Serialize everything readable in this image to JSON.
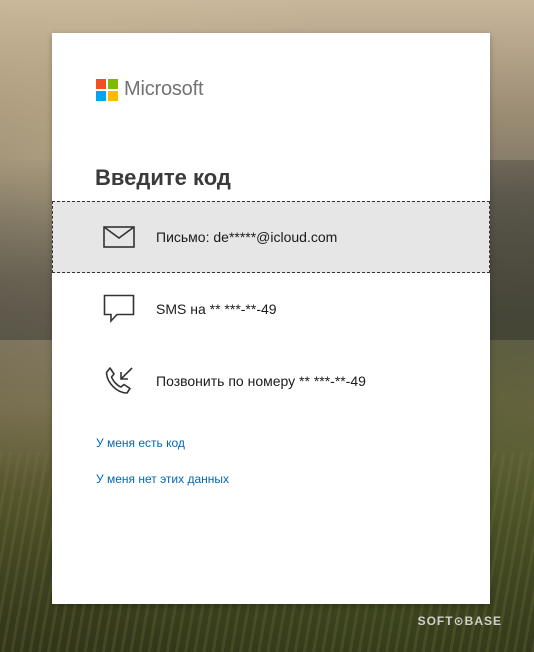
{
  "logo": {
    "text": "Microsoft",
    "colors": [
      "#f25022",
      "#7fba00",
      "#00a4ef",
      "#ffb900"
    ]
  },
  "title": "Введите код",
  "options": [
    {
      "icon": "envelope-icon",
      "label": "Письмо: de*****@icloud.com",
      "selected": true
    },
    {
      "icon": "sms-chat-icon",
      "label": "SMS на ** ***-**-49",
      "selected": false
    },
    {
      "icon": "incoming-call-icon",
      "label": "Позвонить по номеру ** ***-**-49",
      "selected": false
    }
  ],
  "links": {
    "have_code": "У меня есть код",
    "no_data": "У меня нет этих данных"
  },
  "watermark": "SOFT⊙BASE",
  "colors": {
    "link": "#0067b8",
    "selected_bg": "#e6e6e6",
    "card_bg": "#ffffff"
  }
}
